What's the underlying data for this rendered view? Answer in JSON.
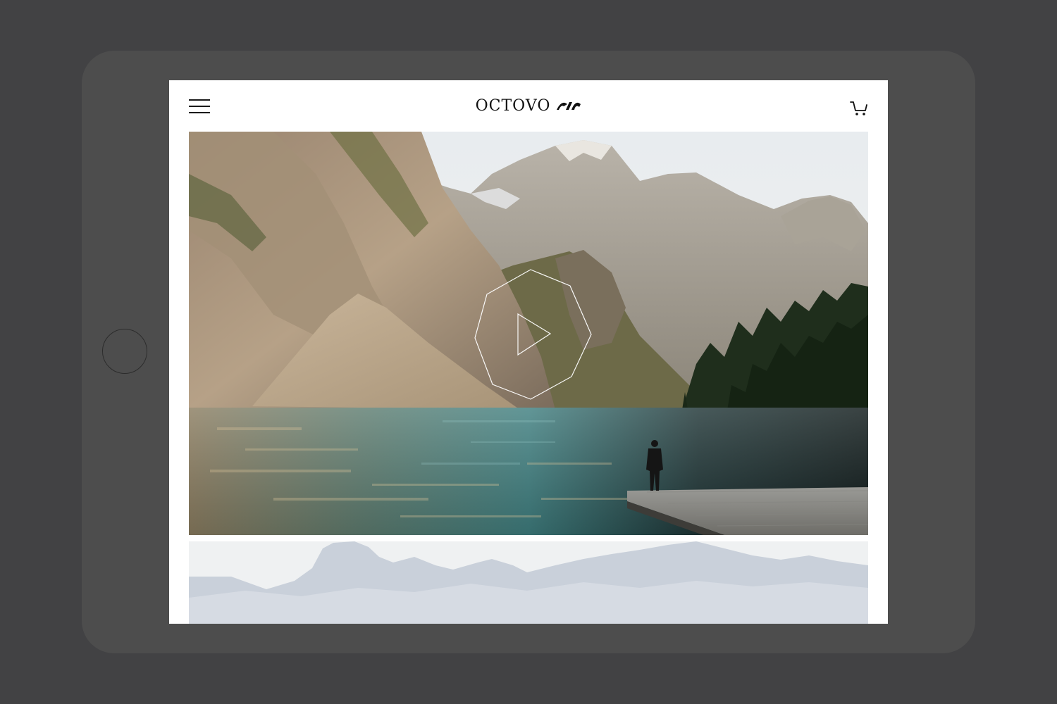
{
  "device": {
    "name": "tablet"
  },
  "header": {
    "logo_text": "OCTOVO",
    "menu_icon": "hamburger-menu-icon",
    "cart_icon": "shopping-cart-icon"
  },
  "hero": {
    "image": "mountain-lake-photo",
    "play_icon": "play-icon"
  },
  "second_section": {
    "image": "misty-mountains-photo"
  },
  "colors": {
    "background": "#424244",
    "tablet_frame": "#4d4d4d",
    "screen": "#ffffff",
    "ink": "#111111"
  }
}
